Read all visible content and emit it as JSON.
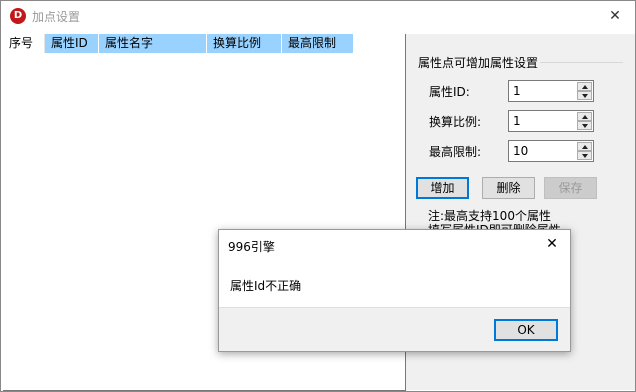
{
  "window": {
    "title": "加点设置",
    "app_icon_letter": "D",
    "close_glyph": "✕"
  },
  "listview": {
    "columns": [
      "序号",
      "属性ID",
      "属性名字",
      "换算比例",
      "最高限制"
    ]
  },
  "panel": {
    "group_title": "属性点可增加属性设置",
    "fields": [
      {
        "label": "属性ID:",
        "value": "1"
      },
      {
        "label": "换算比例:",
        "value": "1"
      },
      {
        "label": "最高限制:",
        "value": "10"
      }
    ],
    "buttons": {
      "add": "增加",
      "delete": "删除",
      "save": "保存"
    },
    "notes": [
      "注:最高支持100个属性",
      "填写属性ID即可删除属性"
    ]
  },
  "dialog": {
    "title": "996引擎",
    "close_glyph": "✕",
    "message": "属性Id不正确",
    "ok_label": "OK"
  },
  "colors": {
    "header_selected": "#99d1ff",
    "default_button_border": "#0078d7",
    "app_icon": "#c21818",
    "panel_bg": "#f0f0f0"
  }
}
